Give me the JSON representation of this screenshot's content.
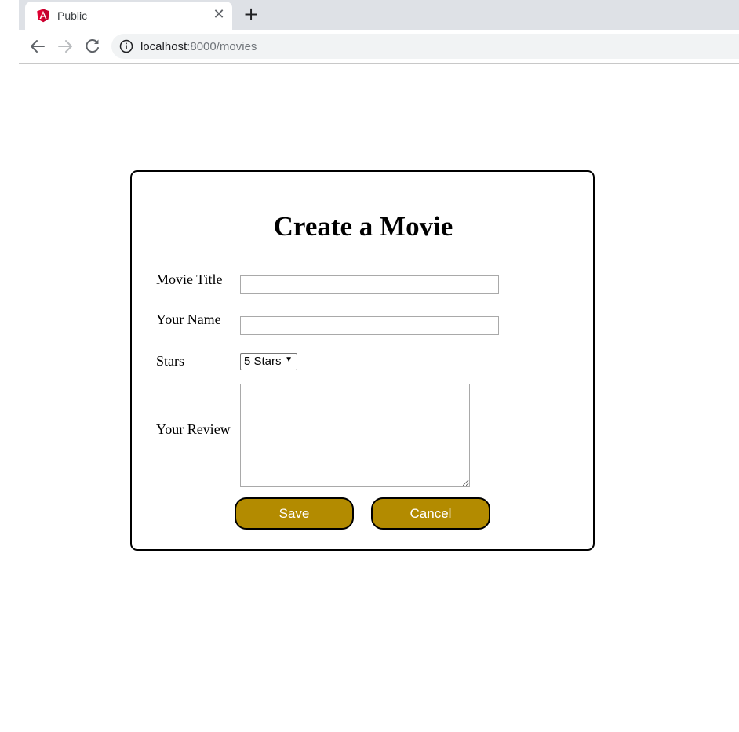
{
  "browser": {
    "tab": {
      "title": "Public",
      "favicon": "angular-logo",
      "close_glyph": "✕"
    },
    "new_tab_glyph": "+",
    "nav": {
      "back_icon": "arrow-left-icon",
      "forward_icon": "arrow-right-icon",
      "reload_icon": "reload-icon"
    },
    "address": {
      "host": "localhost",
      "path": ":8000/movies"
    }
  },
  "form": {
    "title": "Create a Movie",
    "fields": {
      "movie_title": {
        "label": "Movie Title",
        "value": ""
      },
      "your_name": {
        "label": "Your Name",
        "value": ""
      },
      "stars": {
        "label": "Stars",
        "selected": "5 Stars"
      },
      "review": {
        "label": "Your Review",
        "value": ""
      }
    },
    "buttons": {
      "save": "Save",
      "cancel": "Cancel"
    }
  },
  "colors": {
    "button_bg": "#b38b00",
    "button_text": "#ffffff",
    "angular_red": "#dd0031",
    "tabstrip": "#dee1e6",
    "omnibox": "#f1f3f4"
  }
}
